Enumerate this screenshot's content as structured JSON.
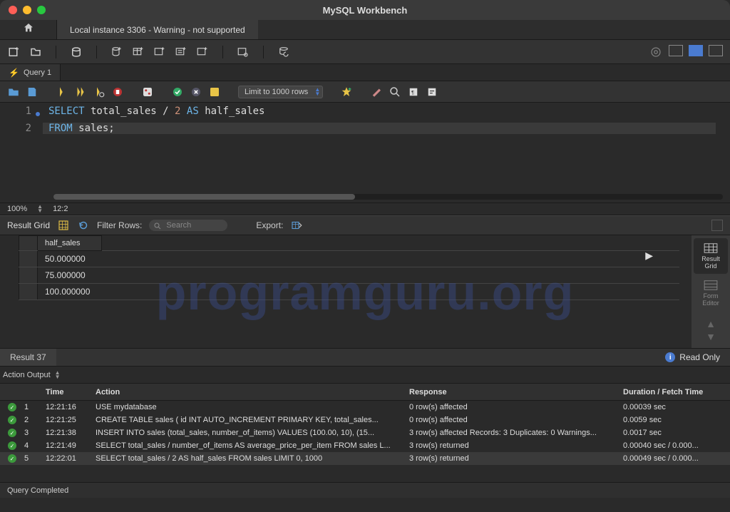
{
  "window": {
    "title": "MySQL Workbench"
  },
  "connection_tab": "Local instance 3306 - Warning - not supported",
  "query_tab": "Query 1",
  "limit_select": "Limit to 1000 rows",
  "editor": {
    "lines": [
      {
        "n": "1",
        "tokens": [
          "SELECT",
          " total_sales ",
          "/",
          " ",
          "2",
          " ",
          "AS",
          " half_sales"
        ]
      },
      {
        "n": "2",
        "tokens": [
          "FROM",
          " sales",
          ";"
        ]
      }
    ]
  },
  "status": {
    "zoom": "100%",
    "cursor": "12:2"
  },
  "result_grid": {
    "label": "Result Grid",
    "filter_label": "Filter Rows:",
    "search_placeholder": "Search",
    "export_label": "Export:",
    "column": "half_sales",
    "rows": [
      "50.000000",
      "75.000000",
      "100.000000"
    ]
  },
  "side": {
    "result_grid": "Result\nGrid",
    "form_editor": "Form\nEditor"
  },
  "result_tab": "Result 37",
  "readonly": "Read Only",
  "output_label": "Action Output",
  "output_headers": {
    "time": "Time",
    "action": "Action",
    "response": "Response",
    "duration": "Duration / Fetch Time"
  },
  "output": [
    {
      "n": "1",
      "time": "12:21:16",
      "action": "USE mydatabase",
      "response": "0 row(s) affected",
      "duration": "0.00039 sec"
    },
    {
      "n": "2",
      "time": "12:21:25",
      "action": "CREATE TABLE sales (     id INT AUTO_INCREMENT PRIMARY KEY,     total_sales...",
      "response": "0 row(s) affected",
      "duration": "0.0059 sec"
    },
    {
      "n": "3",
      "time": "12:21:38",
      "action": "INSERT INTO sales (total_sales, number_of_items) VALUES (100.00, 10),     (15...",
      "response": "3 row(s) affected Records: 3  Duplicates: 0  Warnings...",
      "duration": "0.0017 sec"
    },
    {
      "n": "4",
      "time": "12:21:49",
      "action": "SELECT total_sales / number_of_items AS average_price_per_item FROM sales L...",
      "response": "3 row(s) returned",
      "duration": "0.00040 sec / 0.000..."
    },
    {
      "n": "5",
      "time": "12:22:01",
      "action": "SELECT total_sales / 2 AS half_sales FROM sales LIMIT 0, 1000",
      "response": "3 row(s) returned",
      "duration": "0.00049 sec / 0.000..."
    }
  ],
  "footer": "Query Completed",
  "watermark": "programguru.org"
}
